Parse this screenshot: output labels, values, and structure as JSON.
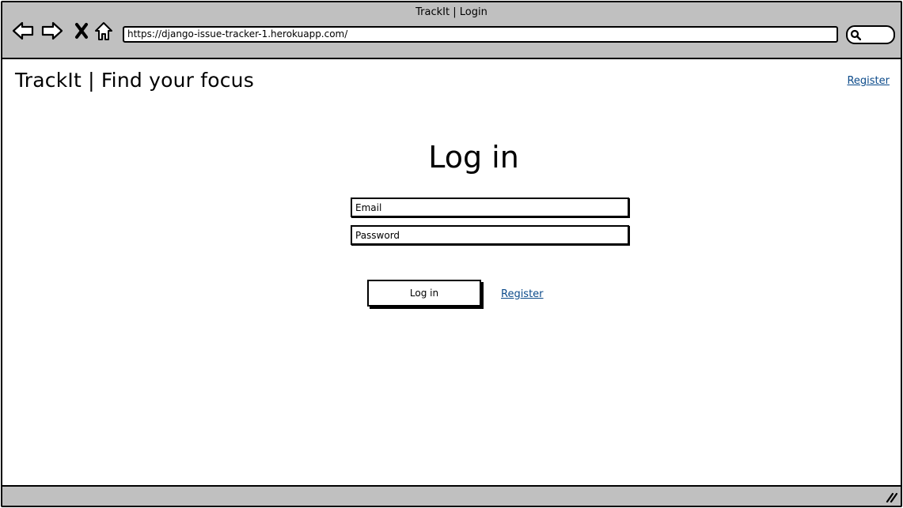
{
  "window": {
    "title": "TrackIt | Login"
  },
  "browser": {
    "url": "https://django-issue-tracker-1.herokuapp.com/",
    "icons": [
      "back-arrow-icon",
      "forward-arrow-icon",
      "close-x-icon",
      "home-icon",
      "search-icon"
    ]
  },
  "header": {
    "site_title": "TrackIt | Find your focus",
    "register_link": "Register"
  },
  "login": {
    "heading": "Log in",
    "email_placeholder": "Email",
    "password_placeholder": "Password",
    "submit_label": "Log in",
    "register_link": "Register"
  },
  "colors": {
    "chrome_bg": "#c0c0c0",
    "link": "#0b4a8a"
  }
}
